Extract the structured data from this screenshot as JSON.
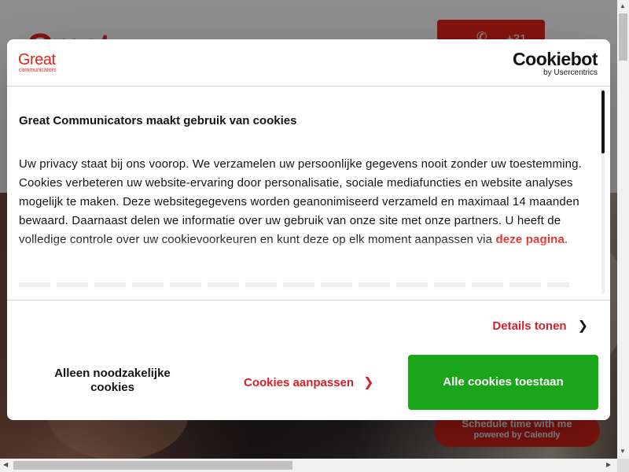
{
  "background_site": {
    "logo_text": "Great",
    "phone_label": "+31",
    "calendly_title": "Schedule time with me",
    "calendly_sub": "powered by Calendly"
  },
  "dialog": {
    "brand_logo_main": "Great",
    "brand_logo_sub": "communicators",
    "cookiebot_main": "Cookiebot",
    "cookiebot_sub": "by Usercentrics",
    "title": "Great Communicators maakt gebruik van cookies",
    "body_text": "Uw privacy staat bij ons voorop. We verzamelen uw persoonlijke gegevens nooit zonder uw toestemming. Cookies verbeteren uw website-ervaring door personalisatie, sociale mediafuncties en website analyses mogelijk te maken. Deze websitegegevens worden geanonimiseerd verzameld en maximaal 14 maanden bewaard. Daarnaast delen we informatie over uw gebruik van onze site met onze partners. U heeft de volledige controle over uw cookievoorkeuren en kunt deze op elk moment aanpassen via",
    "body_link": "deze pagina",
    "body_end": ".",
    "details_label": "Details tonen",
    "btn_necessary": "Alleen noodzakelijke cookies",
    "btn_customize": "Cookies aanpassen",
    "btn_allow_all": "Alle cookies toestaan"
  },
  "icons": {
    "details_chevron": "chevron-right-icon",
    "customize_chevron": "chevron-right-icon",
    "phone": "phone-icon"
  },
  "colors": {
    "brand_red": "#e2231a",
    "link_red": "#d6202d",
    "allow_green": "#1aa51b"
  }
}
